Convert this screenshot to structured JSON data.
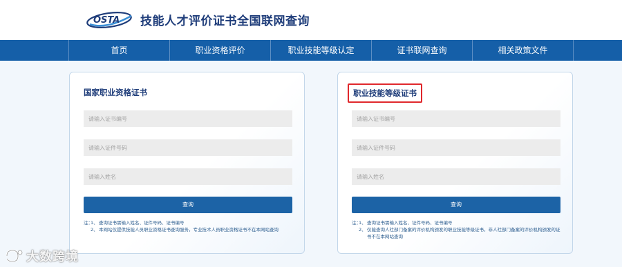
{
  "header": {
    "logo_text": "OSTA",
    "title": "技能人才评价证书全国联网查询"
  },
  "nav": {
    "items": [
      {
        "label": "首页"
      },
      {
        "label": "职业资格评价"
      },
      {
        "label": "职业技能等级认定"
      },
      {
        "label": "证书联网查询"
      },
      {
        "label": "相关政策文件"
      }
    ]
  },
  "cards": [
    {
      "title": "国家职业资格证书",
      "fields": [
        {
          "placeholder": "请输入证书编号",
          "value": ""
        },
        {
          "placeholder": "请输入证件号码",
          "value": ""
        },
        {
          "placeholder": "请输入姓名",
          "value": ""
        }
      ],
      "button_label": "查询",
      "note_prefix": "注：",
      "notes": [
        {
          "num": "1、",
          "text": "查询证书需输入姓名、证件号码、证书编号"
        },
        {
          "num": "2、",
          "text": "本网站仅提供技能人员职业资格证书查询服务，专业技术人员职业资格证书不在本网站查询"
        }
      ]
    },
    {
      "title": "职业技能等级证书",
      "fields": [
        {
          "placeholder": "请输入证书编号",
          "value": ""
        },
        {
          "placeholder": "请输入证件号码",
          "value": ""
        },
        {
          "placeholder": "请输入姓名",
          "value": ""
        }
      ],
      "button_label": "查询",
      "note_prefix": "注：",
      "notes": [
        {
          "num": "1、",
          "text": "查询证书需输入姓名、证件号码、证书编号"
        },
        {
          "num": "2、",
          "text": "仅能查询人社部门备案的评价机构颁发的职业技能等级证书，非人社部门备案的评价机构颁发的证书不在本网站查询"
        }
      ]
    }
  ],
  "watermark": {
    "text": "大数跨境"
  },
  "colors": {
    "nav_bg": "#155fa8",
    "title_color": "#1f3d7a",
    "button_bg": "#1c63a6",
    "highlight_border": "#e0272b"
  }
}
